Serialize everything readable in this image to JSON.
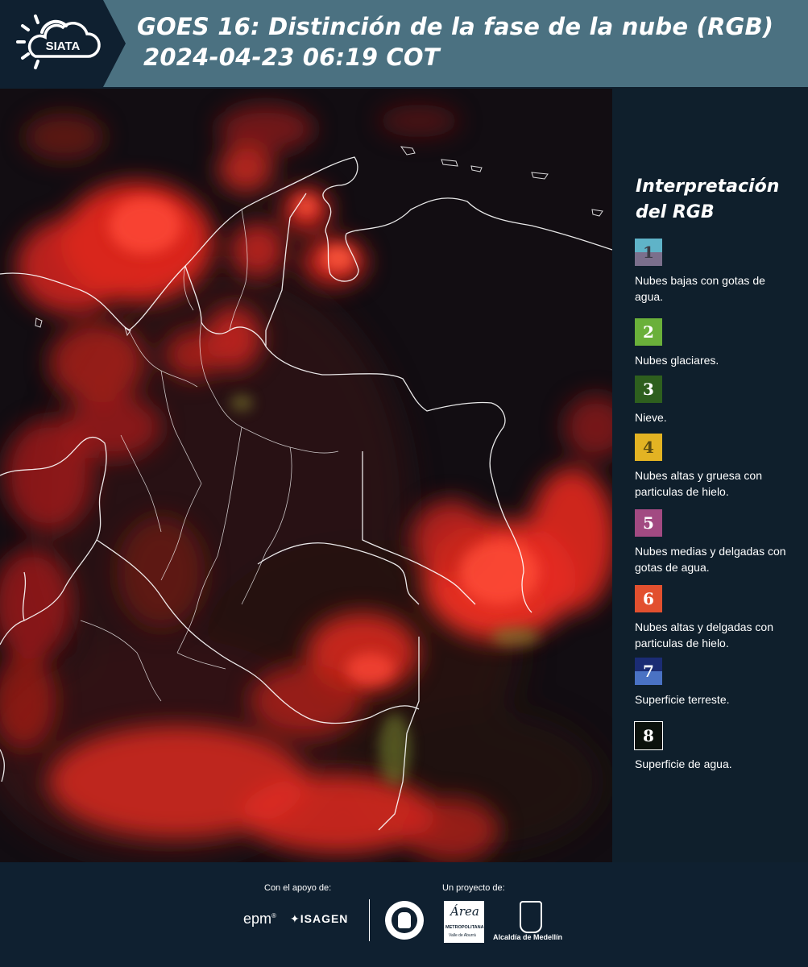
{
  "header": {
    "logo_text": "SIATA",
    "title_line1": "GOES 16: Distinción de la fase de la nube (RGB)",
    "title_line2": "2024-04-23 06:19 COT"
  },
  "legend": {
    "title_line1": "Interpretación",
    "title_line2": "del RGB",
    "items": [
      {
        "num": "1",
        "label": "Nubes bajas con gotas de agua.",
        "color_top": "#5fb3c8",
        "color_bottom": "#7b6f8c",
        "num_color": "#3c3c46"
      },
      {
        "num": "2",
        "label": "Nubes glaciares.",
        "color_top": "#6ab03a",
        "color_bottom": "#6ab03a",
        "num_color": "#ffffff"
      },
      {
        "num": "3",
        "label": "Nieve.",
        "color_top": "#2e5f1e",
        "color_bottom": "#2e5f1e",
        "num_color": "#ffffff"
      },
      {
        "num": "4",
        "label": "Nubes altas y gruesa con particulas de hielo.",
        "color_top": "#e3b323",
        "color_bottom": "#e3b323",
        "num_color": "#5a4a10"
      },
      {
        "num": "5",
        "label": "Nubes medias y delgadas con gotas de agua.",
        "color_top": "#a24a82",
        "color_bottom": "#a24a82",
        "num_color": "#ffffff"
      },
      {
        "num": "6",
        "label": "Nubes altas y delgadas con particulas de hielo.",
        "color_top": "#e2502f",
        "color_bottom": "#e2502f",
        "num_color": "#ffffff"
      },
      {
        "num": "7",
        "label": "Superficie terreste.",
        "color_top": "#1b2c74",
        "color_bottom": "#4a72c4",
        "num_color": "#ffffff"
      },
      {
        "num": "8",
        "label": "Superficie de agua.",
        "color_top": "#0b110c",
        "color_bottom": "#0b110c",
        "num_color": "#ffffff"
      }
    ]
  },
  "footer": {
    "support_label": "Con el apoyo de:",
    "project_label": "Un proyecto de:",
    "sponsor1": "epm",
    "sponsor2": "ISAGEN",
    "org1": "METROPOLITANA",
    "org1_sub": "Valle de Aburrá",
    "org1_script": "Área",
    "org2": "Alcaldía de Medellín"
  }
}
